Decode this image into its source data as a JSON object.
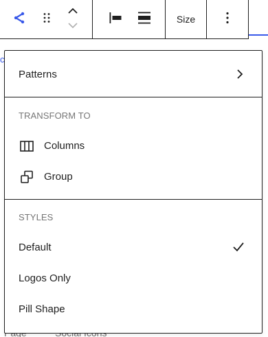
{
  "toolbar": {
    "share_icon": "share-icon",
    "drag_icon": "drag-handle-icon",
    "move_up_icon": "chevron-up-icon",
    "move_down_icon": "chevron-down-icon",
    "justify_left_icon": "justify-left-icon",
    "justify_center_icon": "justify-center-icon",
    "size_label": "Size",
    "more_icon": "more-vertical-icon"
  },
  "menu": {
    "patterns_label": "Patterns",
    "transform_heading": "TRANSFORM TO",
    "transform_items": [
      {
        "label": "Columns",
        "icon": "columns-icon"
      },
      {
        "label": "Group",
        "icon": "group-icon"
      }
    ],
    "styles_heading": "STYLES",
    "style_items": [
      {
        "label": "Default",
        "selected": true
      },
      {
        "label": "Logos Only",
        "selected": false
      },
      {
        "label": "Pill Shape",
        "selected": false
      }
    ]
  },
  "background": {
    "footer_left": "Page",
    "footer_right": "Social Icons"
  },
  "colors": {
    "accent": "#3858e9",
    "text": "#1e1e1e",
    "muted": "#757575"
  }
}
